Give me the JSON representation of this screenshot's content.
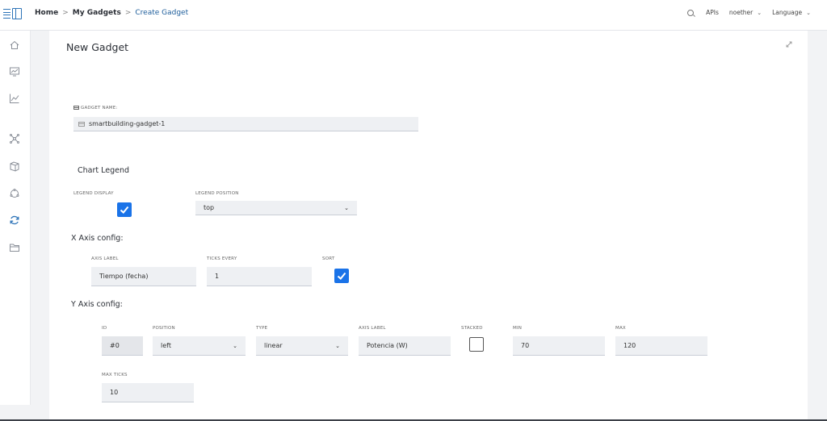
{
  "header": {
    "breadcrumb": {
      "home": "Home",
      "my_gadgets": "My Gadgets",
      "current": "Create Gadget",
      "separator": ">"
    },
    "apis": "APIs",
    "user": "noether",
    "language": "Language",
    "chevron": "⌄"
  },
  "sidebar": {
    "items": [
      {
        "icon": "home-icon"
      },
      {
        "icon": "dashboard-monitor-icon"
      },
      {
        "icon": "line-chart-icon"
      },
      {
        "icon": "network-nodes-icon"
      },
      {
        "icon": "cube-icon"
      },
      {
        "icon": "cycle-icon"
      },
      {
        "icon": "sync-icon"
      },
      {
        "icon": "folder-icon"
      }
    ],
    "active_color": "#2e74b8"
  },
  "main": {
    "title": "New Gadget",
    "gadget_name": {
      "label": "GADGET NAME:",
      "value": "smartbuilding-gadget-1"
    },
    "chart_legend": {
      "title": "Chart Legend",
      "display_label": "LEGEND DISPLAY",
      "display_checked": true,
      "position_label": "LEGEND POSITION",
      "position_value": "top"
    },
    "x_axis": {
      "title": "X Axis config:",
      "axis_label_label": "AXIS LABEL",
      "axis_label_value": "Tiempo (fecha)",
      "ticks_every_label": "TICKS EVERY",
      "ticks_every_value": "1",
      "sort_label": "SORT",
      "sort_checked": true
    },
    "y_axis": {
      "title": "Y Axis config:",
      "id_label": "ID",
      "id_value": "#0",
      "position_label": "POSITION",
      "position_value": "left",
      "type_label": "TYPE",
      "type_value": "linear",
      "axis_label_label": "AXIS LABEL",
      "axis_label_value": "Potencia (W)",
      "stacked_label": "STACKED",
      "stacked_checked": false,
      "min_label": "MIN",
      "min_value": "70",
      "max_label": "MAX",
      "max_value": "120",
      "max_ticks_label": "MAX TICKS",
      "max_ticks_value": "10"
    }
  },
  "colors": {
    "accent": "#1a73e8",
    "breadcrumb_current": "#1d5d9b",
    "field_bg": "#eef0f3"
  }
}
